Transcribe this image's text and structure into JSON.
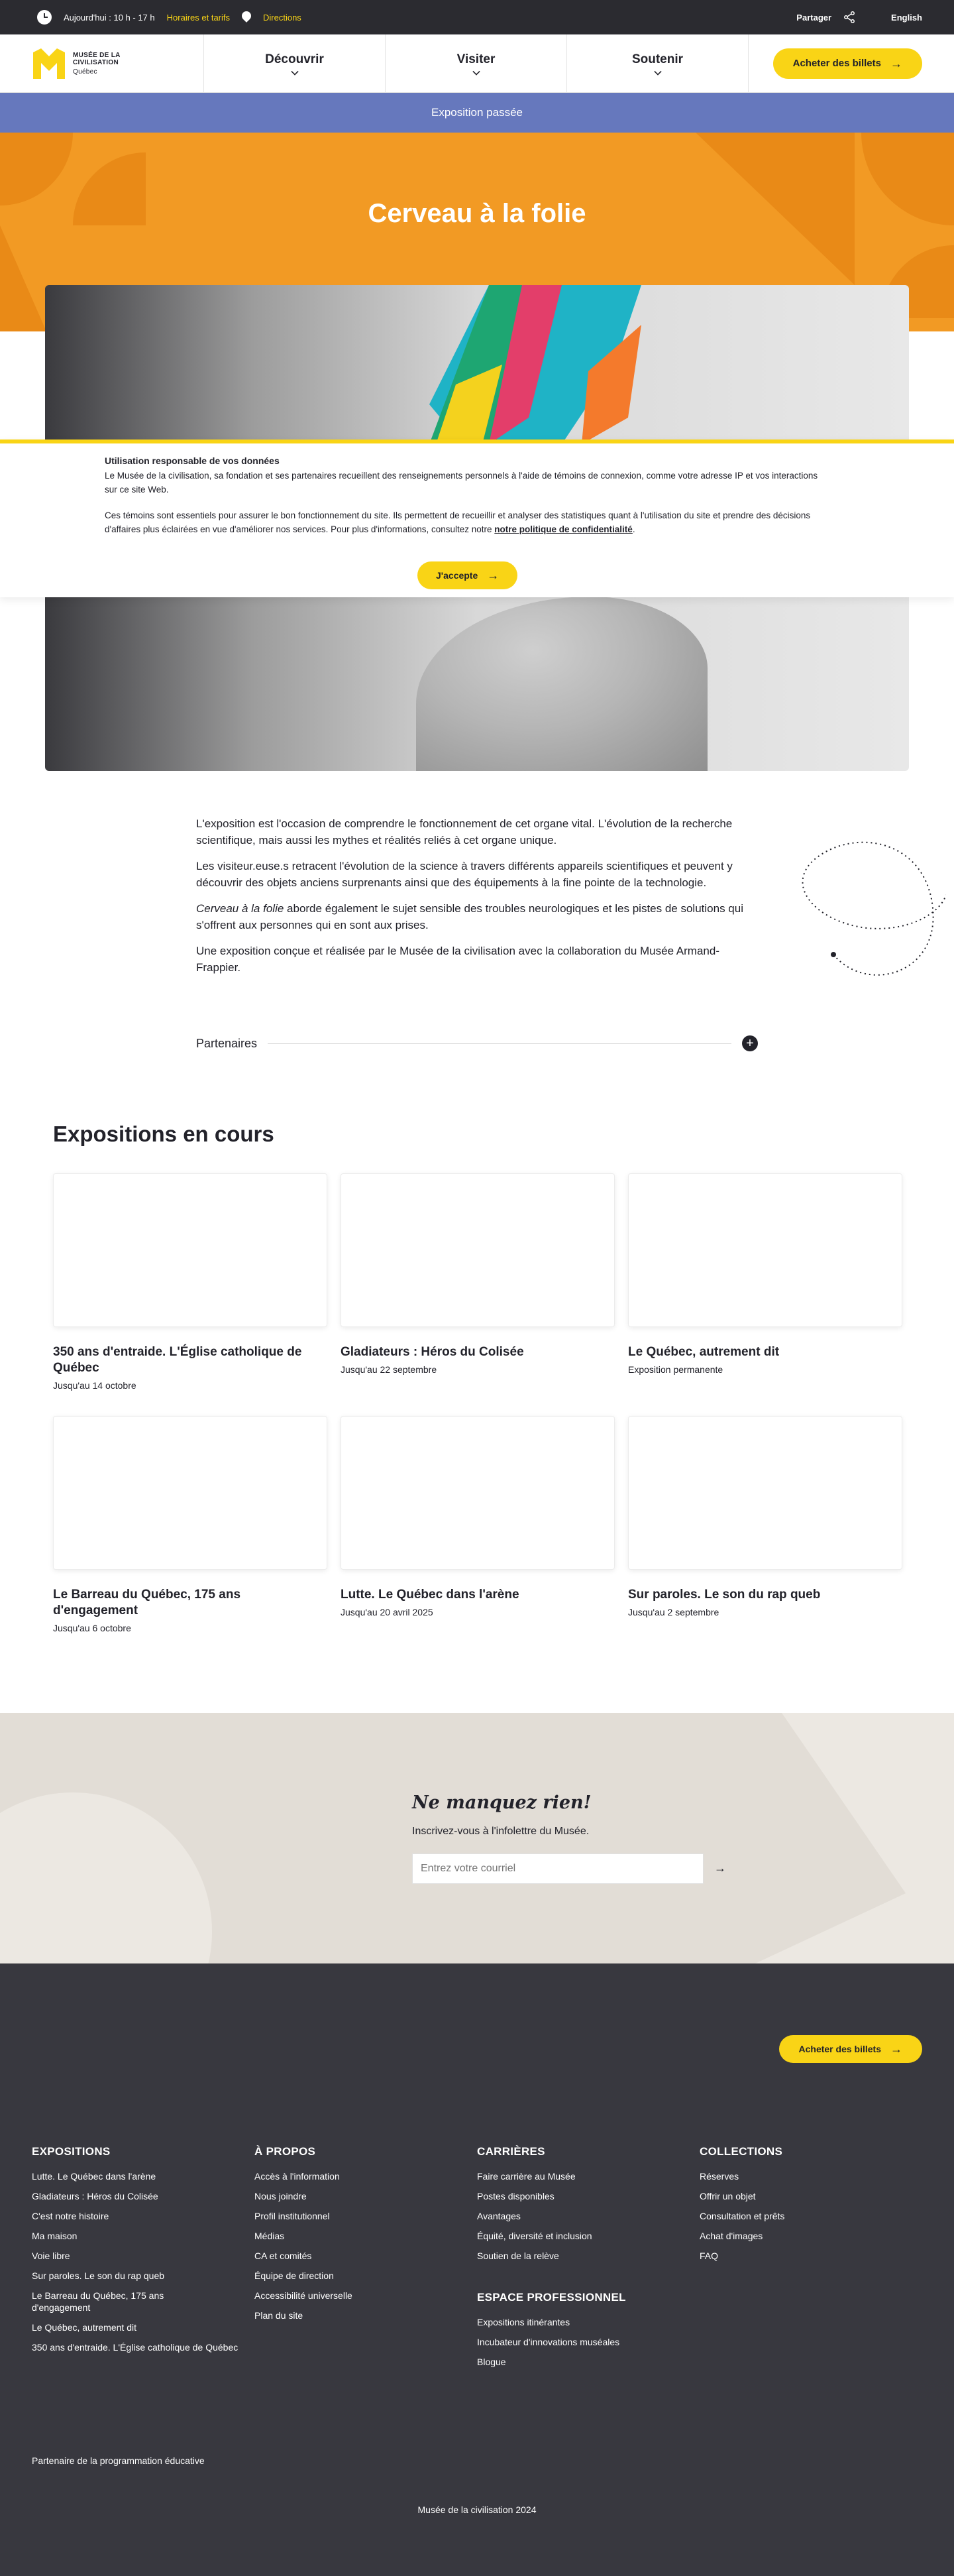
{
  "topbar": {
    "hours": "Aujourd'hui : 10 h - 17 h",
    "hours_link": "Horaires et tarifs",
    "directions": "Directions",
    "share": "Partager",
    "language": "English"
  },
  "logo": {
    "line1": "MUSÉE DE LA",
    "line2": "CIVILISATION",
    "gov": "Québec"
  },
  "nav": {
    "items": [
      {
        "label": "Découvrir"
      },
      {
        "label": "Visiter"
      },
      {
        "label": "Soutenir"
      }
    ],
    "cta": "Acheter des billets"
  },
  "banner": {
    "status": "Exposition passée"
  },
  "hero": {
    "title": "Cerveau à la folie"
  },
  "colors": {
    "accent_yellow": "#f9d416",
    "hero_orange": "#f29a24",
    "banner_blue": "#6678bd",
    "footer_dark": "#38383f"
  },
  "cookie": {
    "title": "Utilisation responsable de vos données",
    "p1": "Le Musée de la civilisation, sa fondation et ses partenaires recueillent des renseignements personnels à l'aide de témoins de connexion, comme votre adresse IP et vos interactions sur ce site Web.",
    "p2": "Ces témoins sont essentiels pour assurer le bon fonctionnement du site. Ils permettent de recueillir et analyser des statistiques quant à l'utilisation du site et prendre des décisions d'affaires plus éclairées en vue d'améliorer nos services. Pour plus d'informations, consultez notre",
    "policy_link": "notre politique de confidentialité",
    "accept": "J'accepte"
  },
  "intro": {
    "p1": "L'exposition est l'occasion de comprendre le fonctionnement de cet organe vital. L'évolution de la recherche scientifique, mais aussi les mythes et réalités reliés à cet organe unique.",
    "p2": "Les visiteur.euse.s retracent l'évolution de la science à travers différents appareils scientifiques et peuvent y découvrir des objets anciens surprenants ainsi que des équipements à la fine pointe de la technologie.",
    "p3_em": "Cerveau à la folie",
    "p3_rest": " aborde également le sujet sensible des troubles neurologiques et les pistes de solutions qui s'offrent aux personnes qui en sont aux prises.",
    "p4": "Une exposition conçue et réalisée par le Musée de la civilisation avec la collaboration du Musée Armand-Frappier.",
    "partners": "Partenaires"
  },
  "expositions": {
    "title": "Expositions en cours",
    "cards": [
      {
        "title": "350 ans d'entraide. L'Église catholique de Québec",
        "sub": "Jusqu'au 14 octobre"
      },
      {
        "title": "Gladiateurs : Héros du Colisée",
        "sub": "Jusqu'au 22 septembre"
      },
      {
        "title": "Le Québec, autrement dit",
        "sub": "Exposition permanente"
      },
      {
        "title": "Le Barreau du Québec, 175 ans d'engagement",
        "sub": "Jusqu'au 6 octobre"
      },
      {
        "title": "Lutte. Le Québec dans l'arène",
        "sub": "Jusqu'au 20 avril 2025"
      },
      {
        "title": "Sur paroles. Le son du rap queb",
        "sub": "Jusqu'au 2 septembre"
      }
    ]
  },
  "newsletter": {
    "title": "Ne manquez rien!",
    "lead": "Inscrivez-vous à l'infolettre du Musée.",
    "placeholder": "Entrez votre courriel"
  },
  "footer": {
    "cta": "Acheter des billets",
    "columns": [
      {
        "title": "EXPOSITIONS",
        "items": [
          "Lutte. Le Québec dans l'arène",
          "Gladiateurs : Héros du Colisée",
          "C'est notre histoire",
          "Ma maison",
          "Voie libre",
          "Sur paroles. Le son du rap queb",
          "Le Barreau du Québec, 175 ans d'engagement",
          "Le Québec, autrement dit",
          "350 ans d'entraide. L'Église catholique de Québec"
        ]
      },
      {
        "title": "À PROPOS",
        "items": [
          "Accès à l'information",
          "Nous joindre",
          "Profil institutionnel",
          "Médias",
          "CA et comités",
          "Équipe de direction",
          "Accessibilité universelle",
          "Plan du site"
        ]
      },
      {
        "title": "CARRIÈRES",
        "items": [
          "Faire carrière au Musée",
          "Postes disponibles",
          "Avantages",
          "Équité, diversité et inclusion",
          "Soutien de la relève"
        ]
      },
      {
        "title": "COLLECTIONS",
        "items": [
          "Réserves",
          "Offrir un objet",
          "Consultation et prêts",
          "Achat d'images",
          "FAQ"
        ]
      }
    ],
    "pro": {
      "title": "ESPACE PROFESSIONNEL",
      "items": [
        "Expositions itinérantes",
        "Incubateur d'innovations muséales",
        "Blogue"
      ]
    },
    "partner_note": "Partenaire de la programmation éducative",
    "copyright": "Musée de la civilisation 2024"
  }
}
